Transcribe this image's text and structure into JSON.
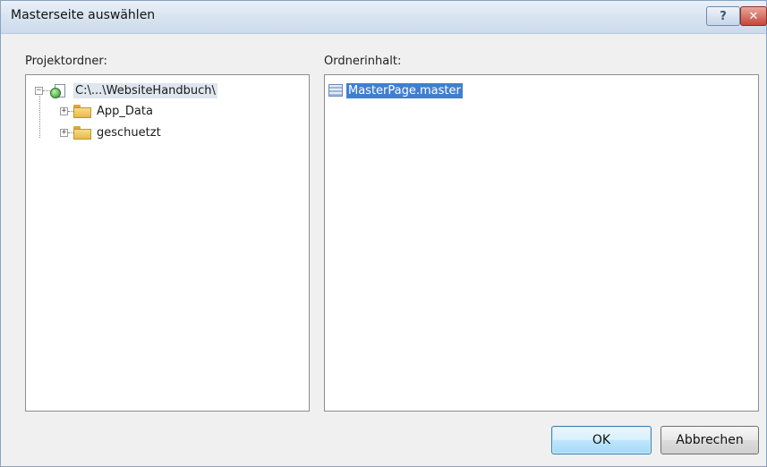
{
  "window": {
    "title": "Masterseite auswählen",
    "help_label": "?",
    "close_label": "✕"
  },
  "left": {
    "label": "Projektordner:",
    "root": {
      "label": "C:\\...\\WebsiteHandbuch\\",
      "icon": "web-project-icon"
    },
    "children": [
      {
        "label": "App_Data",
        "icon": "folder-icon"
      },
      {
        "label": "geschuetzt",
        "icon": "folder-icon"
      }
    ]
  },
  "right": {
    "label": "Ordnerinhalt:",
    "items": [
      {
        "label": "MasterPage.master",
        "icon": "master-page-icon",
        "selected": true
      }
    ]
  },
  "buttons": {
    "ok": "OK",
    "cancel": "Abbrechen"
  },
  "colors": {
    "selection": "#3f7fd1",
    "title_bar": "#d9e4f1",
    "ok_button": "#bee6fd",
    "close_button": "#c4483a"
  }
}
